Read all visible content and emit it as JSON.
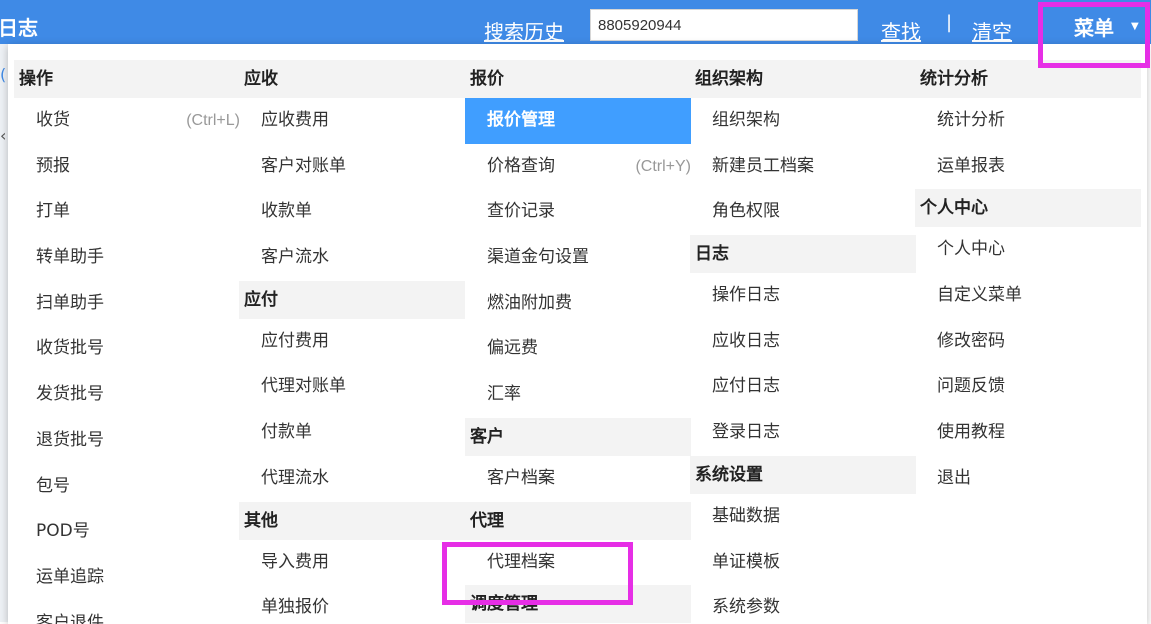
{
  "header": {
    "title": "日志",
    "search_history_label": "搜索历史",
    "search_value": "8805920944",
    "find_label": "查找",
    "separator": "|",
    "clear_label": "清空",
    "menu_label": "菜单"
  },
  "menu": {
    "columns": [
      {
        "sections": [
          {
            "title": "操作",
            "items": [
              {
                "label": "收货",
                "shortcut": "(Ctrl+L)"
              },
              {
                "label": "预报"
              },
              {
                "label": "打单"
              },
              {
                "label": "转单助手"
              },
              {
                "label": "扫单助手"
              },
              {
                "label": "收货批号"
              },
              {
                "label": "发货批号"
              },
              {
                "label": "退货批号"
              },
              {
                "label": "包号"
              },
              {
                "label": "POD号"
              },
              {
                "label": "运单追踪"
              },
              {
                "label": "客户退件"
              }
            ]
          }
        ]
      },
      {
        "sections": [
          {
            "title": "应收",
            "items": [
              {
                "label": "应收费用"
              },
              {
                "label": "客户对账单"
              },
              {
                "label": "收款单"
              },
              {
                "label": "客户流水"
              }
            ]
          },
          {
            "title": "应付",
            "items": [
              {
                "label": "应付费用"
              },
              {
                "label": "代理对账单"
              },
              {
                "label": "付款单"
              },
              {
                "label": "代理流水"
              }
            ]
          },
          {
            "title": "其他",
            "items": [
              {
                "label": "导入费用"
              },
              {
                "label": "单独报价"
              }
            ]
          }
        ]
      },
      {
        "sections": [
          {
            "title": "报价",
            "items": [
              {
                "label": "报价管理",
                "active": true
              },
              {
                "label": "价格查询",
                "shortcut": "(Ctrl+Y)"
              },
              {
                "label": "查价记录"
              },
              {
                "label": "渠道金句设置"
              },
              {
                "label": "燃油附加费"
              },
              {
                "label": "偏远费"
              },
              {
                "label": "汇率"
              }
            ]
          },
          {
            "title": "客户",
            "items": [
              {
                "label": "客户档案"
              }
            ]
          },
          {
            "title": "代理",
            "items": [
              {
                "label": "代理档案"
              }
            ]
          },
          {
            "title": "调度管理",
            "items": []
          }
        ]
      },
      {
        "sections": [
          {
            "title": "组织架构",
            "items": [
              {
                "label": "组织架构"
              },
              {
                "label": "新建员工档案"
              },
              {
                "label": "角色权限"
              }
            ]
          },
          {
            "title": "日志",
            "items": [
              {
                "label": "操作日志"
              },
              {
                "label": "应收日志"
              },
              {
                "label": "应付日志"
              },
              {
                "label": "登录日志"
              }
            ]
          },
          {
            "title": "系统设置",
            "items": [
              {
                "label": "基础数据"
              },
              {
                "label": "单证模板"
              },
              {
                "label": "系统参数"
              }
            ]
          }
        ]
      },
      {
        "sections": [
          {
            "title": "统计分析",
            "items": [
              {
                "label": "统计分析"
              },
              {
                "label": "运单报表"
              }
            ]
          },
          {
            "title": "个人中心",
            "items": [
              {
                "label": "个人中心"
              },
              {
                "label": "自定义菜单"
              },
              {
                "label": "修改密码"
              },
              {
                "label": "问题反馈"
              },
              {
                "label": "使用教程"
              },
              {
                "label": "退出"
              }
            ]
          }
        ]
      }
    ]
  }
}
